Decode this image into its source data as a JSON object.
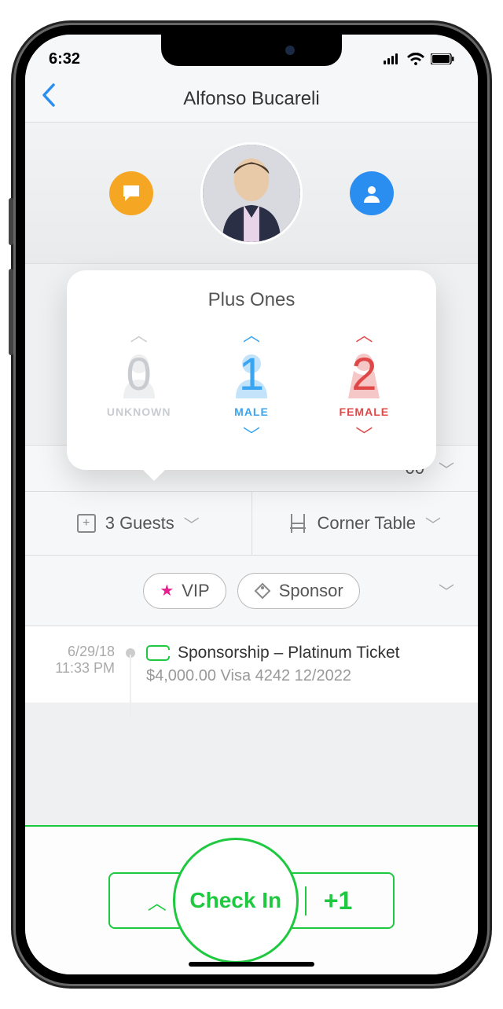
{
  "status": {
    "time": "6:32"
  },
  "nav": {
    "title": "Alfonso Bucareli"
  },
  "plusOnes": {
    "title": "Plus Ones",
    "unknown": {
      "value": "0",
      "label": "UNKNOWN"
    },
    "male": {
      "value": "1",
      "label": "MALE"
    },
    "female": {
      "value": "2",
      "label": "FEMALE"
    }
  },
  "peek": {
    "value": "00"
  },
  "guests": {
    "label": "3 Guests"
  },
  "table": {
    "label": "Corner Table"
  },
  "tags": {
    "vip": "VIP",
    "sponsor": "Sponsor"
  },
  "ticket": {
    "date": "6/29/18",
    "time": "11:33 PM",
    "title": "Sponsorship – Platinum Ticket",
    "sub": "$4,000.00 Visa 4242 12/2022"
  },
  "checkin": {
    "label": "Check In",
    "plus": "+1"
  }
}
